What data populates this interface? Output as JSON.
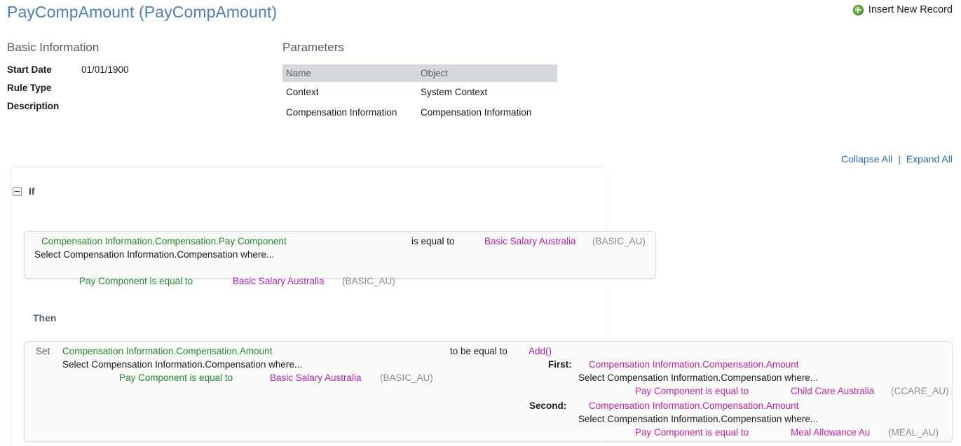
{
  "header": {
    "title": "PayCompAmount (PayCompAmount)",
    "insert_new_record": "Insert New Record",
    "insert_icon": "plus-circle-icon",
    "title_color": "#4a7ebb"
  },
  "basic_information": {
    "section_title": "Basic Information",
    "rows": [
      {
        "label": "Start Date",
        "value": "01/01/1900"
      },
      {
        "label": "Rule Type",
        "value": ""
      },
      {
        "label": "Description",
        "value": ""
      }
    ]
  },
  "parameters": {
    "section_title": "Parameters",
    "columns": [
      "Name",
      "Object"
    ],
    "rows": [
      {
        "name": "Context",
        "object": "System Context"
      },
      {
        "name": "Compensation Information",
        "object": "Compensation Information"
      }
    ]
  },
  "tree_actions": {
    "collapse_all": "Collapse All",
    "separator": "|",
    "expand_all": "Expand All",
    "link_color": "#1f6fb5"
  },
  "rule": {
    "if_label": "If",
    "then_label": "Then",
    "toggle_state": "expanded",
    "if_condition": {
      "line1_left": "Compensation Information.Compensation.Pay Component",
      "line1_operator": "is equal to",
      "line1_value": "Basic Salary Australia",
      "line1_value_code": "(BASIC_AU)",
      "line2": "Select Compensation Information.Compensation where...",
      "line3_left": "Pay Component is equal to",
      "line3_value": "Basic Salary Australia",
      "line3_value_code": "(BASIC_AU)"
    },
    "then_action": {
      "set_keyword": "Set",
      "target": "Compensation Information.Compensation.Amount",
      "target_select": "Select Compensation Information.Compensation where...",
      "target_filter_left": "Pay Component is equal to",
      "target_filter_value": "Basic Salary Australia",
      "target_filter_code": "(BASIC_AU)",
      "operator": "to be equal to",
      "function": "Add()",
      "arguments": [
        {
          "label": "First:",
          "value": "Compensation Information.Compensation.Amount",
          "select": "Select Compensation Information.Compensation where...",
          "filter_left": "Pay Component is equal to",
          "filter_value": "Child Care Australia",
          "filter_code": "(CCARE_AU)"
        },
        {
          "label": "Second:",
          "value": "Compensation Information.Compensation.Amount",
          "select": "Select Compensation Information.Compensation where...",
          "filter_left": "Pay Component is equal to",
          "filter_value": "Meal Allowance Au",
          "filter_code": "(MEAL_AU)"
        }
      ]
    }
  },
  "colors": {
    "green": "#1f8a2c",
    "purple": "#b41fb4",
    "magenta": "#c421a6",
    "gray": "#8d8d8d",
    "link": "#1f6fb5",
    "title": "#4a7ebb",
    "table_header_bg": "#d4d9de"
  }
}
